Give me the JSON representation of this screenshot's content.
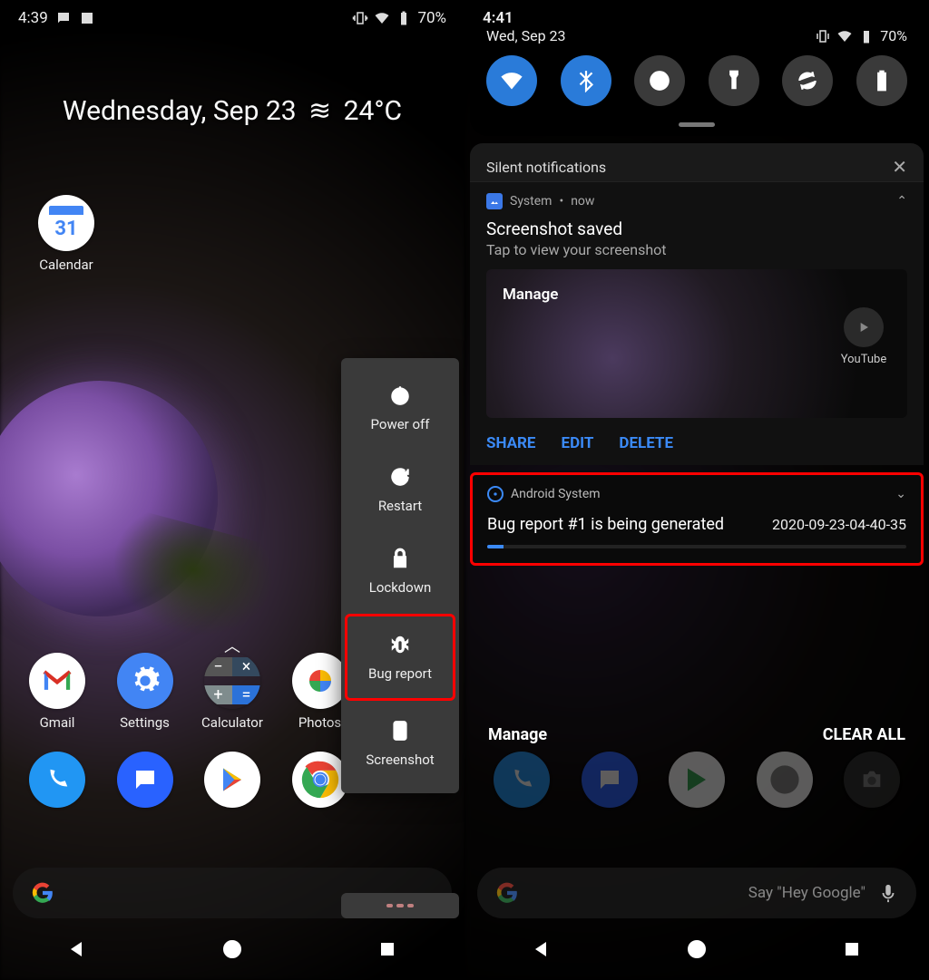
{
  "left": {
    "statusbar": {
      "time": "4:39",
      "battery": "70%"
    },
    "widget": {
      "date": "Wednesday, Sep 23",
      "temp": "24°C"
    },
    "calendar": {
      "day": "31",
      "label": "Calendar"
    },
    "apps_row1": {
      "gmail": "Gmail",
      "settings": "Settings",
      "calculator": "Calculator",
      "photos": "Photos"
    },
    "power_menu": {
      "power_off": "Power off",
      "restart": "Restart",
      "lockdown": "Lockdown",
      "bug_report": "Bug report",
      "screenshot": "Screenshot"
    }
  },
  "right": {
    "statusbar": {
      "time": "4:41"
    },
    "shade": {
      "date": "Wed, Sep 23",
      "battery": "70%",
      "silent_header": "Silent notifications"
    },
    "notif_screenshot": {
      "app": "System",
      "time": "now",
      "title": "Screenshot saved",
      "subtitle": "Tap to view your screenshot",
      "manage": "Manage",
      "youtube": "YouTube",
      "share": "SHARE",
      "edit": "EDIT",
      "delete": "DELETE"
    },
    "notif_bug": {
      "app": "Android System",
      "title": "Bug report #1 is being generated",
      "timestamp": "2020-09-23-04-40-35"
    },
    "bottom": {
      "manage": "Manage",
      "clear_all": "CLEAR ALL"
    },
    "search_placeholder": "Say \"Hey Google\""
  }
}
